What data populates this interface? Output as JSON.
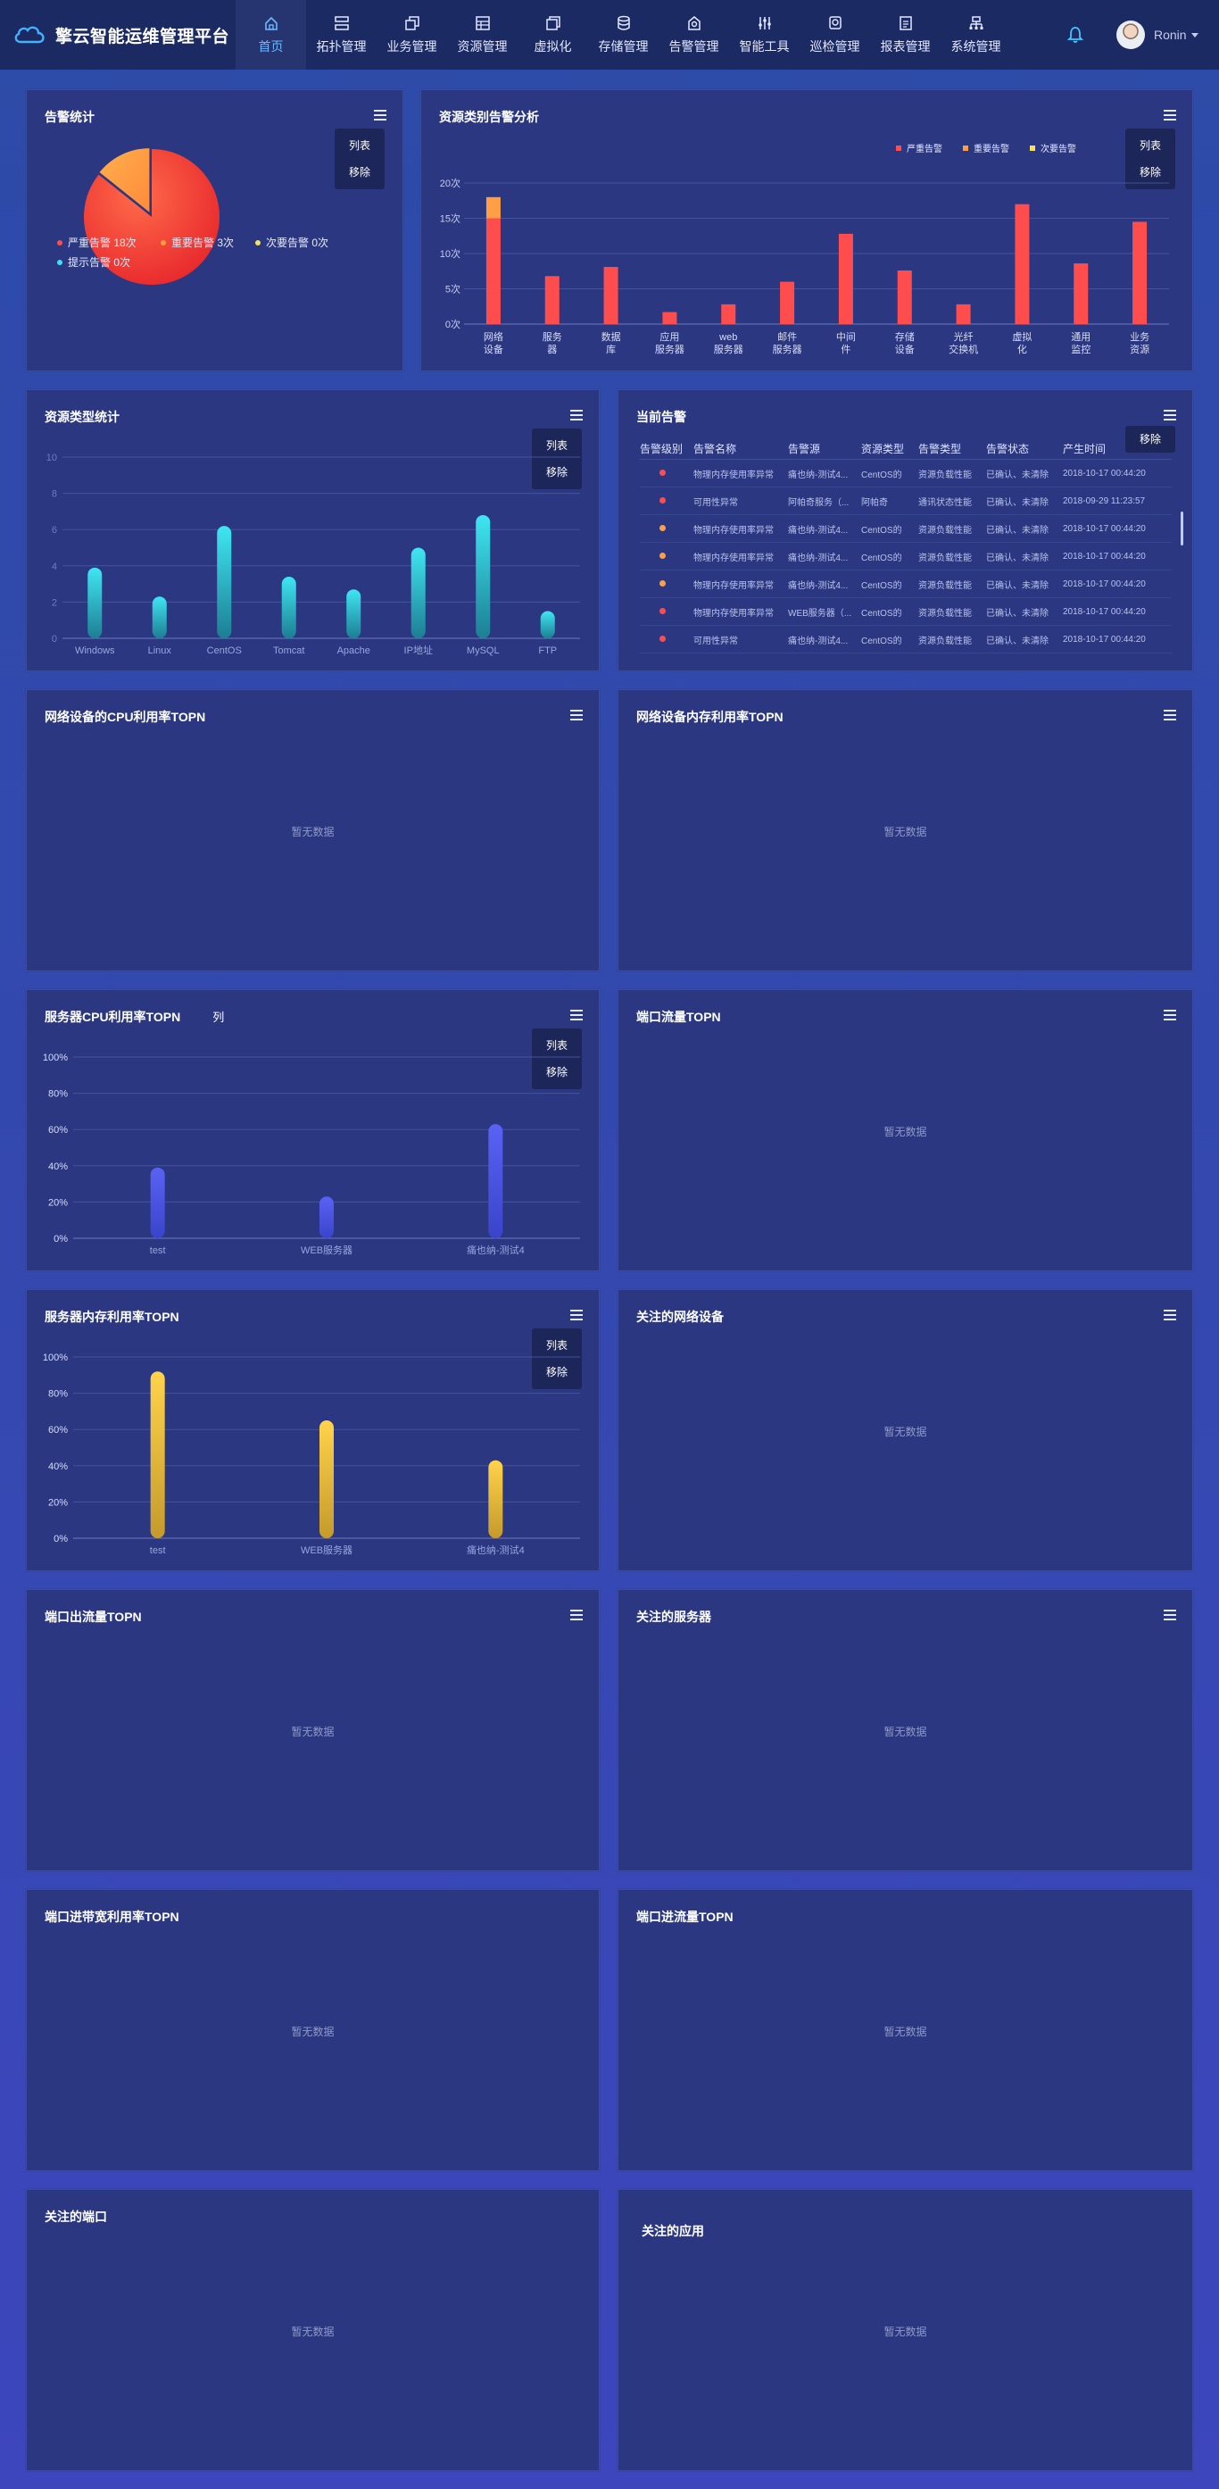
{
  "app": {
    "title": "擎云智能运维管理平台",
    "user": "Ronin"
  },
  "nav": [
    {
      "label": "首页",
      "icon": "home-icon",
      "active": true
    },
    {
      "label": "拓扑管理",
      "icon": "topology-icon"
    },
    {
      "label": "业务管理",
      "icon": "business-icon"
    },
    {
      "label": "资源管理",
      "icon": "resource-icon"
    },
    {
      "label": "虚拟化",
      "icon": "virtual-icon"
    },
    {
      "label": "存储管理",
      "icon": "storage-icon"
    },
    {
      "label": "告警管理",
      "icon": "alarm-icon"
    },
    {
      "label": "智能工具",
      "icon": "tools-icon"
    },
    {
      "label": "巡检管理",
      "icon": "inspect-icon"
    },
    {
      "label": "报表管理",
      "icon": "report-icon"
    },
    {
      "label": "系统管理",
      "icon": "system-icon"
    }
  ],
  "menu": {
    "list": "列表",
    "remove": "移除"
  },
  "nodata": "暂无数据",
  "colors": {
    "critical": "#ff4c4c",
    "major": "#ff9f45",
    "minor": "#f5e15a",
    "info": "#3fe0f0"
  },
  "panels": {
    "alarm_stats": {
      "title": "告警统计",
      "legend": [
        {
          "label": "严重告警 18次",
          "color": "#ff4c4c"
        },
        {
          "label": "重要告警 3次",
          "color": "#ff9f45"
        },
        {
          "label": "次要告警  0次",
          "color": "#f5e15a"
        },
        {
          "label": "提示告警 0次",
          "color": "#3fe0f0"
        }
      ]
    },
    "res_alarm": {
      "title": "资源类别告警分析",
      "legend": [
        "严重告警",
        "重要告警",
        "次要告警"
      ]
    },
    "res_type": {
      "title": "资源类型统计"
    },
    "current_alarm": {
      "title": "当前告警",
      "headers": [
        "告警级别",
        "告警名称",
        "告警源",
        "资源类型",
        "告警类型",
        "告警状态",
        "产生时间"
      ],
      "rows": [
        {
          "level": "#ff4c4c",
          "name": "物理内存使用率异常",
          "src": "痛也纳-测试4...",
          "type": "CentOS的",
          "atype": "资源负载性能",
          "state": "已确认、未清除",
          "time": "2018-10-17 00:44:20"
        },
        {
          "level": "#ff4c4c",
          "name": "可用性异常",
          "src": "阿帕奇服务（...",
          "type": "阿帕奇",
          "atype": "通讯状态性能",
          "state": "已确认、未清除",
          "time": "2018-09-29 11:23:57"
        },
        {
          "level": "#ff9f45",
          "name": "物理内存使用率异常",
          "src": "痛也纳-测试4...",
          "type": "CentOS的",
          "atype": "资源负载性能",
          "state": "已确认、未清除",
          "time": "2018-10-17 00:44:20"
        },
        {
          "level": "#ff9f45",
          "name": "物理内存使用率异常",
          "src": "痛也纳-测试4...",
          "type": "CentOS的",
          "atype": "资源负载性能",
          "state": "已确认、未清除",
          "time": "2018-10-17 00:44:20"
        },
        {
          "level": "#ff9f45",
          "name": "物理内存使用率异常",
          "src": "痛也纳-测试4...",
          "type": "CentOS的",
          "atype": "资源负载性能",
          "state": "已确认、未清除",
          "time": "2018-10-17 00:44:20"
        },
        {
          "level": "#ff4c4c",
          "name": "物理内存使用率异常",
          "src": "WEB服务器（...",
          "type": "CentOS的",
          "atype": "资源负载性能",
          "state": "已确认、未清除",
          "time": "2018-10-17 00:44:20"
        },
        {
          "level": "#ff4c4c",
          "name": "可用性异常",
          "src": "痛也纳-测试4...",
          "type": "CentOS的",
          "atype": "资源负载性能",
          "state": "已确认、未清除",
          "time": "2018-10-17 00:44:20"
        }
      ]
    },
    "net_cpu": {
      "title": "网络设备的CPU利用率TOPN"
    },
    "net_mem": {
      "title": "网络设备内存利用率TOPN"
    },
    "srv_cpu": {
      "title": "服务器CPU利用率TOPN",
      "extra": "列"
    },
    "port_flow": {
      "title": "端口流量TOPN"
    },
    "srv_mem": {
      "title": "服务器内存利用率TOPN"
    },
    "fav_net": {
      "title": "关注的网络设备"
    },
    "port_out": {
      "title": "端口出流量TOPN"
    },
    "fav_srv": {
      "title": "关注的服务器"
    },
    "port_bw": {
      "title": "端口进带宽利用率TOPN"
    },
    "port_in": {
      "title": "端口进流量TOPN"
    },
    "fav_port": {
      "title": "关注的端口"
    },
    "fav_app": {
      "title": "关注的应用"
    }
  },
  "chart_data": [
    {
      "type": "pie",
      "title": "告警统计",
      "labels": [
        "严重告警",
        "重要告警",
        "次要告警",
        "提示告警"
      ],
      "values": [
        18,
        3,
        0,
        0
      ]
    },
    {
      "type": "bar",
      "title": "资源类别告警分析",
      "categories": [
        "网络\n设备",
        "服务\n器",
        "数据\n库",
        "应用\n服务器",
        "web\n服务器",
        "邮件\n服务器",
        "中间\n件",
        "存储\n设备",
        "光纤\n交换机",
        "虚拟\n化",
        "通用\n监控",
        "业务\n资源"
      ],
      "series": [
        {
          "name": "严重告警",
          "values": [
            15,
            6.8,
            8.1,
            1.7,
            2.8,
            6,
            12.8,
            7.6,
            2.8,
            17,
            8.6,
            14.5
          ]
        },
        {
          "name": "重要告警",
          "values": [
            3,
            0,
            0,
            0,
            0,
            0,
            0,
            0,
            0,
            0,
            0,
            0
          ]
        },
        {
          "name": "次要告警",
          "values": [
            0,
            0,
            0,
            0,
            0,
            0,
            0,
            0,
            0,
            0,
            0,
            0
          ]
        }
      ],
      "yticks": [
        "0次",
        "5次",
        "10次",
        "15次",
        "20次"
      ],
      "ylim": [
        0,
        20
      ]
    },
    {
      "type": "bar",
      "title": "资源类型统计",
      "categories": [
        "Windows",
        "Linux",
        "CentOS",
        "Tomcat",
        "Apache",
        "IP地址",
        "MySQL",
        "FTP"
      ],
      "values": [
        3.9,
        2.3,
        6.2,
        3.4,
        2.7,
        5,
        6.8,
        1.5
      ],
      "ylim": [
        0,
        10
      ],
      "yticks": [
        "0",
        "2",
        "4",
        "6",
        "8",
        "10"
      ]
    },
    {
      "type": "bar",
      "title": "服务器CPU利用率TOPN",
      "categories": [
        "test",
        "WEB服务器",
        "痛也纳-测试4"
      ],
      "values": [
        39,
        23,
        63
      ],
      "ylim": [
        0,
        100
      ],
      "yticks": [
        "0%",
        "20%",
        "40%",
        "60%",
        "80%",
        "100%"
      ]
    },
    {
      "type": "bar",
      "title": "服务器内存利用率TOPN",
      "categories": [
        "test",
        "WEB服务器",
        "痛也纳-测试4"
      ],
      "values": [
        92,
        65,
        43
      ],
      "ylim": [
        0,
        100
      ],
      "yticks": [
        "0%",
        "20%",
        "40%",
        "60%",
        "80%",
        "100%"
      ]
    }
  ]
}
